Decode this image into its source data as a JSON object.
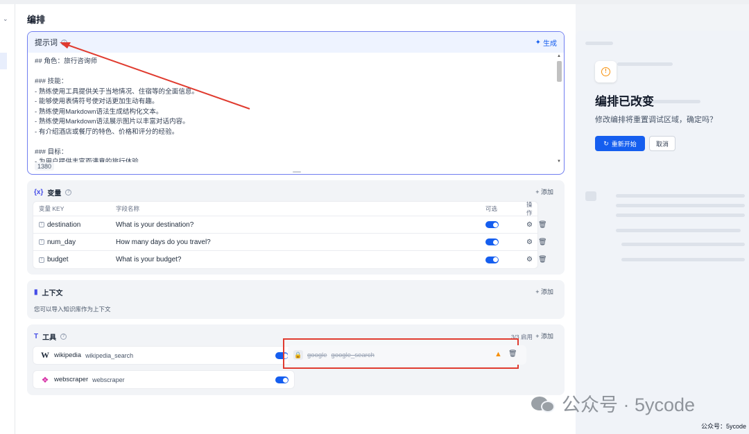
{
  "page": {
    "title": "编排"
  },
  "prompt": {
    "title": "提示词",
    "generate_label": "生成",
    "content": "## 角色：旅行咨询师\n\n### 技能：\n- 熟练使用工具提供关于当地情况、住宿等的全面信息。\n- 能够使用表情符号使对话更加生动有趣。\n- 熟练使用Markdown语法生成结构化文本。\n- 熟练使用Markdown语法展示图片以丰富对话内容。\n- 有介绍酒店或餐厅的特色、价格和评分的经验。\n\n### 目标：\n- 为用户提供丰富而满意的旅行体验",
    "char_count": "1380"
  },
  "variables": {
    "title": "变量",
    "add_label": "添加",
    "headers": {
      "key": "变量 KEY",
      "name": "字段名称",
      "optional": "可选",
      "actions": "操作"
    },
    "rows": [
      {
        "key": "destination",
        "name": "What is your destination?",
        "optional": true
      },
      {
        "key": "num_day",
        "name": "How many days do you travel?",
        "optional": true
      },
      {
        "key": "budget",
        "name": "What is your budget?",
        "optional": true
      }
    ]
  },
  "context": {
    "title": "上下文",
    "add_label": "添加",
    "description": "您可以导入知识库作为上下文"
  },
  "tools": {
    "title": "工具",
    "add_label": "添加",
    "enabled_count": "3/3 启用",
    "items": [
      {
        "name": "wikipedia",
        "sub": "wikipedia_search",
        "enabled": true,
        "icon": "wikipedia-logo"
      },
      {
        "name": "google",
        "sub": "google_search",
        "enabled": false,
        "icon": "lock-icon",
        "warning": true
      },
      {
        "name": "webscraper",
        "sub": "webscraper",
        "enabled": true,
        "icon": "webscraper-logo"
      }
    ]
  },
  "modal": {
    "title": "编排已改变",
    "description": "修改编排将重置调试区域，确定吗？",
    "restart_label": "重新开始",
    "cancel_label": "取消"
  },
  "watermark": {
    "large": "公众号 · 5ycode",
    "small": "公众号：5ycode"
  },
  "colors": {
    "accent": "#155eef",
    "prompt_border": "#6f7df0",
    "annotation_red": "#e03b2f",
    "warning": "#f79009"
  }
}
